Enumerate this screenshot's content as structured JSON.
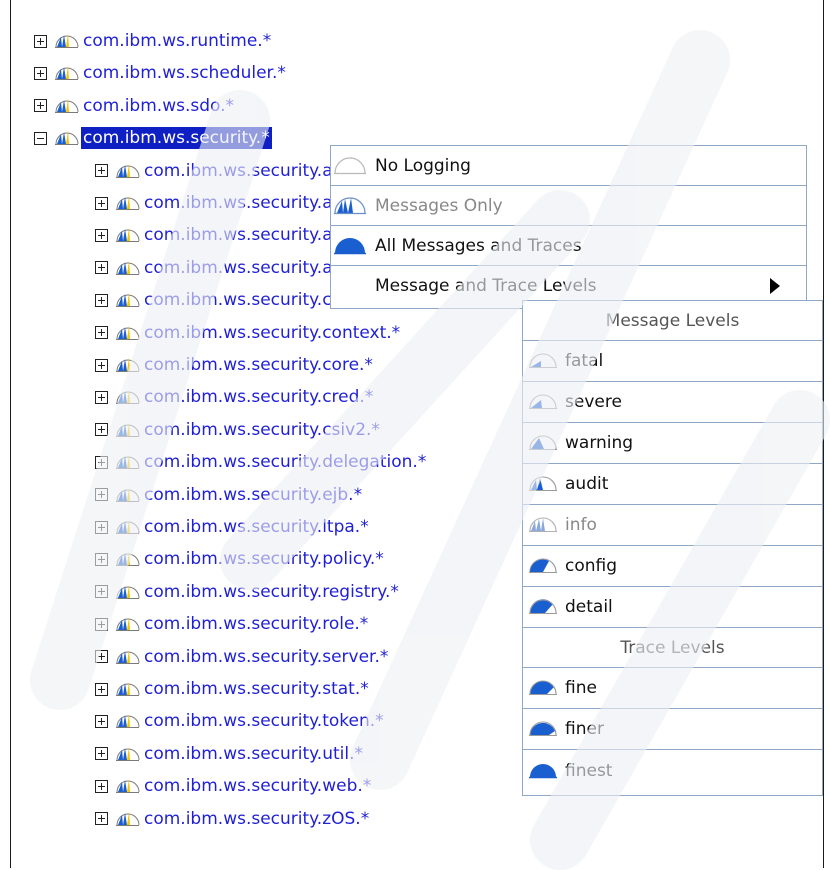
{
  "tree": {
    "nodes": [
      {
        "label": "com.ibm.ws.runtime.*",
        "expander": "plus"
      },
      {
        "label": "com.ibm.ws.scheduler.*",
        "expander": "plus"
      },
      {
        "label": "com.ibm.ws.sdo.*",
        "expander": "plus"
      },
      {
        "label": "com.ibm.ws.security.*",
        "expander": "minus",
        "selected": true
      },
      {
        "label": "com.ibm.ws.security.acme.*",
        "expander": "plus",
        "child": true
      },
      {
        "label": "com.ibm.ws.security.admin.*",
        "expander": "plus",
        "child": true
      },
      {
        "label": "com.ibm.ws.security.audit.*",
        "expander": "plus",
        "child": true
      },
      {
        "label": "com.ibm.ws.security.auth.*",
        "expander": "plus",
        "child": true
      },
      {
        "label": "com.ibm.ws.security.config.*",
        "expander": "plus",
        "child": true
      },
      {
        "label": "com.ibm.ws.security.context.*",
        "expander": "plus",
        "child": true
      },
      {
        "label": "com.ibm.ws.security.core.*",
        "expander": "plus",
        "child": true
      },
      {
        "label": "com.ibm.ws.security.cred.*",
        "expander": "plus",
        "child": true
      },
      {
        "label": "com.ibm.ws.security.csiv2.*",
        "expander": "plus",
        "child": true
      },
      {
        "label": "com.ibm.ws.security.delegation.*",
        "expander": "plus",
        "child": true
      },
      {
        "label": "com.ibm.ws.security.ejb.*",
        "expander": "plus",
        "child": true
      },
      {
        "label": "com.ibm.ws.security.ltpa.*",
        "expander": "plus",
        "child": true
      },
      {
        "label": "com.ibm.ws.security.policy.*",
        "expander": "plus",
        "child": true
      },
      {
        "label": "com.ibm.ws.security.registry.*",
        "expander": "plus",
        "child": true
      },
      {
        "label": "com.ibm.ws.security.role.*",
        "expander": "plus",
        "child": true
      },
      {
        "label": "com.ibm.ws.security.server.*",
        "expander": "plus",
        "child": true
      },
      {
        "label": "com.ibm.ws.security.stat.*",
        "expander": "plus",
        "child": true
      },
      {
        "label": "com.ibm.ws.security.token.*",
        "expander": "plus",
        "child": true
      },
      {
        "label": "com.ibm.ws.security.util.*",
        "expander": "plus",
        "child": true
      },
      {
        "label": "com.ibm.ws.security.web.*",
        "expander": "plus",
        "child": true
      },
      {
        "label": "com.ibm.ws.security.zOS.*",
        "expander": "plus",
        "child": true
      }
    ]
  },
  "context_menu": {
    "items": [
      {
        "label": "No Logging",
        "icon": "no-logging-icon",
        "disabled": false
      },
      {
        "label": "Messages Only",
        "icon": "messages-only-icon",
        "disabled": true
      },
      {
        "label": "All Messages and Traces",
        "icon": "all-messages-traces-icon",
        "disabled": false
      },
      {
        "label": "Message and Trace Levels",
        "icon": "",
        "disabled": false,
        "submenu": true
      }
    ]
  },
  "submenu": {
    "message_header": "Message Levels",
    "trace_header": "Trace Levels",
    "message_levels": [
      {
        "label": "fatal",
        "icon": "fatal-icon",
        "disabled": false
      },
      {
        "label": "severe",
        "icon": "severe-icon",
        "disabled": false
      },
      {
        "label": "warning",
        "icon": "warning-icon",
        "disabled": false
      },
      {
        "label": "audit",
        "icon": "audit-icon",
        "disabled": false
      },
      {
        "label": "info",
        "icon": "info-icon",
        "disabled": true
      },
      {
        "label": "config",
        "icon": "config-icon",
        "disabled": false
      },
      {
        "label": "detail",
        "icon": "detail-icon",
        "disabled": false
      }
    ],
    "trace_levels": [
      {
        "label": "fine",
        "icon": "fine-icon",
        "disabled": false
      },
      {
        "label": "finer",
        "icon": "finer-icon",
        "disabled": false
      },
      {
        "label": "finest",
        "icon": "finest-icon",
        "disabled": false
      }
    ]
  },
  "colors": {
    "link": "#1f1fd6",
    "selection": "#0e1fc4",
    "menu_border": "#8fa8c8",
    "icon_blue": "#1a5fd0"
  }
}
